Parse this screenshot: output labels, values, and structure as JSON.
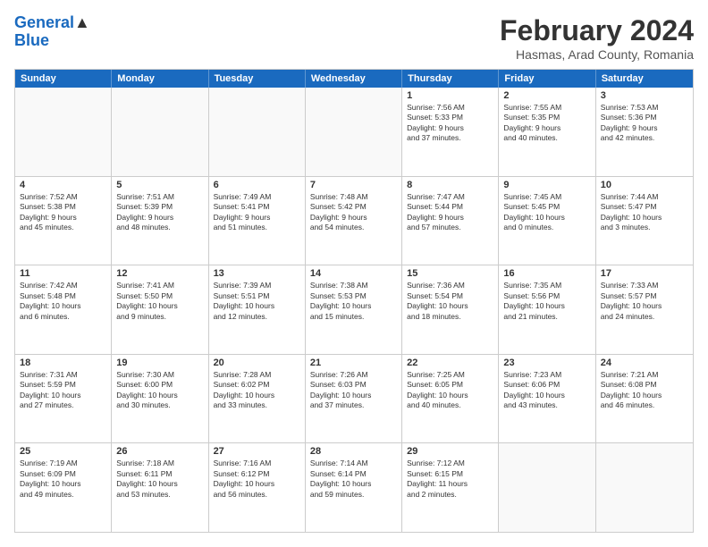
{
  "header": {
    "logo_line1": "General",
    "logo_line2": "Blue",
    "main_title": "February 2024",
    "subtitle": "Hasmas, Arad County, Romania"
  },
  "calendar": {
    "days_of_week": [
      "Sunday",
      "Monday",
      "Tuesday",
      "Wednesday",
      "Thursday",
      "Friday",
      "Saturday"
    ],
    "rows": [
      [
        {
          "day": "",
          "info": ""
        },
        {
          "day": "",
          "info": ""
        },
        {
          "day": "",
          "info": ""
        },
        {
          "day": "",
          "info": ""
        },
        {
          "day": "1",
          "info": "Sunrise: 7:56 AM\nSunset: 5:33 PM\nDaylight: 9 hours\nand 37 minutes."
        },
        {
          "day": "2",
          "info": "Sunrise: 7:55 AM\nSunset: 5:35 PM\nDaylight: 9 hours\nand 40 minutes."
        },
        {
          "day": "3",
          "info": "Sunrise: 7:53 AM\nSunset: 5:36 PM\nDaylight: 9 hours\nand 42 minutes."
        }
      ],
      [
        {
          "day": "4",
          "info": "Sunrise: 7:52 AM\nSunset: 5:38 PM\nDaylight: 9 hours\nand 45 minutes."
        },
        {
          "day": "5",
          "info": "Sunrise: 7:51 AM\nSunset: 5:39 PM\nDaylight: 9 hours\nand 48 minutes."
        },
        {
          "day": "6",
          "info": "Sunrise: 7:49 AM\nSunset: 5:41 PM\nDaylight: 9 hours\nand 51 minutes."
        },
        {
          "day": "7",
          "info": "Sunrise: 7:48 AM\nSunset: 5:42 PM\nDaylight: 9 hours\nand 54 minutes."
        },
        {
          "day": "8",
          "info": "Sunrise: 7:47 AM\nSunset: 5:44 PM\nDaylight: 9 hours\nand 57 minutes."
        },
        {
          "day": "9",
          "info": "Sunrise: 7:45 AM\nSunset: 5:45 PM\nDaylight: 10 hours\nand 0 minutes."
        },
        {
          "day": "10",
          "info": "Sunrise: 7:44 AM\nSunset: 5:47 PM\nDaylight: 10 hours\nand 3 minutes."
        }
      ],
      [
        {
          "day": "11",
          "info": "Sunrise: 7:42 AM\nSunset: 5:48 PM\nDaylight: 10 hours\nand 6 minutes."
        },
        {
          "day": "12",
          "info": "Sunrise: 7:41 AM\nSunset: 5:50 PM\nDaylight: 10 hours\nand 9 minutes."
        },
        {
          "day": "13",
          "info": "Sunrise: 7:39 AM\nSunset: 5:51 PM\nDaylight: 10 hours\nand 12 minutes."
        },
        {
          "day": "14",
          "info": "Sunrise: 7:38 AM\nSunset: 5:53 PM\nDaylight: 10 hours\nand 15 minutes."
        },
        {
          "day": "15",
          "info": "Sunrise: 7:36 AM\nSunset: 5:54 PM\nDaylight: 10 hours\nand 18 minutes."
        },
        {
          "day": "16",
          "info": "Sunrise: 7:35 AM\nSunset: 5:56 PM\nDaylight: 10 hours\nand 21 minutes."
        },
        {
          "day": "17",
          "info": "Sunrise: 7:33 AM\nSunset: 5:57 PM\nDaylight: 10 hours\nand 24 minutes."
        }
      ],
      [
        {
          "day": "18",
          "info": "Sunrise: 7:31 AM\nSunset: 5:59 PM\nDaylight: 10 hours\nand 27 minutes."
        },
        {
          "day": "19",
          "info": "Sunrise: 7:30 AM\nSunset: 6:00 PM\nDaylight: 10 hours\nand 30 minutes."
        },
        {
          "day": "20",
          "info": "Sunrise: 7:28 AM\nSunset: 6:02 PM\nDaylight: 10 hours\nand 33 minutes."
        },
        {
          "day": "21",
          "info": "Sunrise: 7:26 AM\nSunset: 6:03 PM\nDaylight: 10 hours\nand 37 minutes."
        },
        {
          "day": "22",
          "info": "Sunrise: 7:25 AM\nSunset: 6:05 PM\nDaylight: 10 hours\nand 40 minutes."
        },
        {
          "day": "23",
          "info": "Sunrise: 7:23 AM\nSunset: 6:06 PM\nDaylight: 10 hours\nand 43 minutes."
        },
        {
          "day": "24",
          "info": "Sunrise: 7:21 AM\nSunset: 6:08 PM\nDaylight: 10 hours\nand 46 minutes."
        }
      ],
      [
        {
          "day": "25",
          "info": "Sunrise: 7:19 AM\nSunset: 6:09 PM\nDaylight: 10 hours\nand 49 minutes."
        },
        {
          "day": "26",
          "info": "Sunrise: 7:18 AM\nSunset: 6:11 PM\nDaylight: 10 hours\nand 53 minutes."
        },
        {
          "day": "27",
          "info": "Sunrise: 7:16 AM\nSunset: 6:12 PM\nDaylight: 10 hours\nand 56 minutes."
        },
        {
          "day": "28",
          "info": "Sunrise: 7:14 AM\nSunset: 6:14 PM\nDaylight: 10 hours\nand 59 minutes."
        },
        {
          "day": "29",
          "info": "Sunrise: 7:12 AM\nSunset: 6:15 PM\nDaylight: 11 hours\nand 2 minutes."
        },
        {
          "day": "",
          "info": ""
        },
        {
          "day": "",
          "info": ""
        }
      ]
    ]
  }
}
